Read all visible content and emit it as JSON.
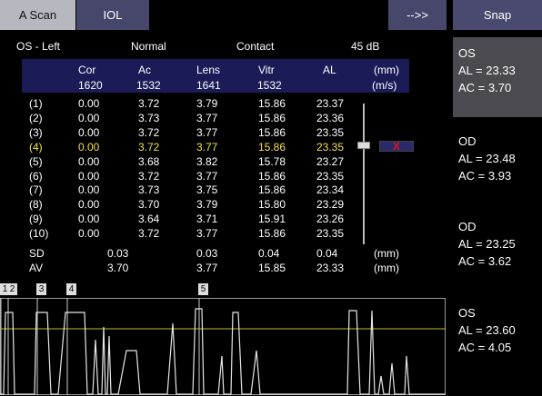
{
  "tabs": {
    "ascan": "A Scan",
    "iol": "IOL",
    "next": "-->>",
    "snap": "Snap"
  },
  "header": {
    "eye": "OS - Left",
    "mode": "Normal",
    "probe": "Contact",
    "gain": "45 dB"
  },
  "columns": [
    {
      "name": "Cor",
      "velocity": "1620"
    },
    {
      "name": "Ac",
      "velocity": "1532"
    },
    {
      "name": "Lens",
      "velocity": "1641"
    },
    {
      "name": "Vitr",
      "velocity": "1532"
    },
    {
      "name": "AL",
      "velocity": ""
    },
    {
      "name": "(mm)",
      "velocity": "(m/s)"
    }
  ],
  "rows": [
    [
      "(1)",
      "0.00",
      "3.72",
      "3.79",
      "15.86",
      "23.37"
    ],
    [
      "(2)",
      "0.00",
      "3.73",
      "3.77",
      "15.86",
      "23.36"
    ],
    [
      "(3)",
      "0.00",
      "3.72",
      "3.77",
      "15.86",
      "23.35"
    ],
    [
      "(4)",
      "0.00",
      "3.72",
      "3.77",
      "15.86",
      "23.35"
    ],
    [
      "(5)",
      "0.00",
      "3.68",
      "3.82",
      "15.78",
      "23.27"
    ],
    [
      "(6)",
      "0.00",
      "3.72",
      "3.77",
      "15.86",
      "23.35"
    ],
    [
      "(7)",
      "0.00",
      "3.73",
      "3.75",
      "15.86",
      "23.34"
    ],
    [
      "(8)",
      "0.00",
      "3.70",
      "3.79",
      "15.80",
      "23.29"
    ],
    [
      "(9)",
      "0.00",
      "3.64",
      "3.71",
      "15.91",
      "23.26"
    ],
    [
      "(10)",
      "0.00",
      "3.72",
      "3.77",
      "15.86",
      "23.35"
    ]
  ],
  "selected_row": 4,
  "delete_mark": "X",
  "stats": {
    "sd": {
      "label": "SD",
      "cor_ac": "0.03",
      "lens": "0.03",
      "vitr": "0.04",
      "al": "0.04",
      "unit": "(mm)"
    },
    "av": {
      "label": "AV",
      "cor_ac": "3.70",
      "lens": "3.77",
      "vitr": "15.85",
      "al": "23.33",
      "unit": "(mm)"
    }
  },
  "gate_markers": [
    "1",
    "2",
    "3",
    "4",
    "5"
  ],
  "snapshots": [
    {
      "eye": "OS",
      "al": "AL = 23.33",
      "ac": "AC = 3.70"
    },
    {
      "eye": "OD",
      "al": "AL = 23.48",
      "ac": "AC = 3.93"
    },
    {
      "eye": "OD",
      "al": "AL = 23.25",
      "ac": "AC = 3.62"
    },
    {
      "eye": "OS",
      "al": "AL = 23.60",
      "ac": "AC = 4.05"
    }
  ],
  "colors": {
    "highlight": "#f2e04a",
    "delete": "#e01818",
    "table_header": "#1b1b58",
    "tab_active": "#b7b7c0",
    "tab_inactive": "#47476c",
    "threshold_line": "#c8b828"
  }
}
